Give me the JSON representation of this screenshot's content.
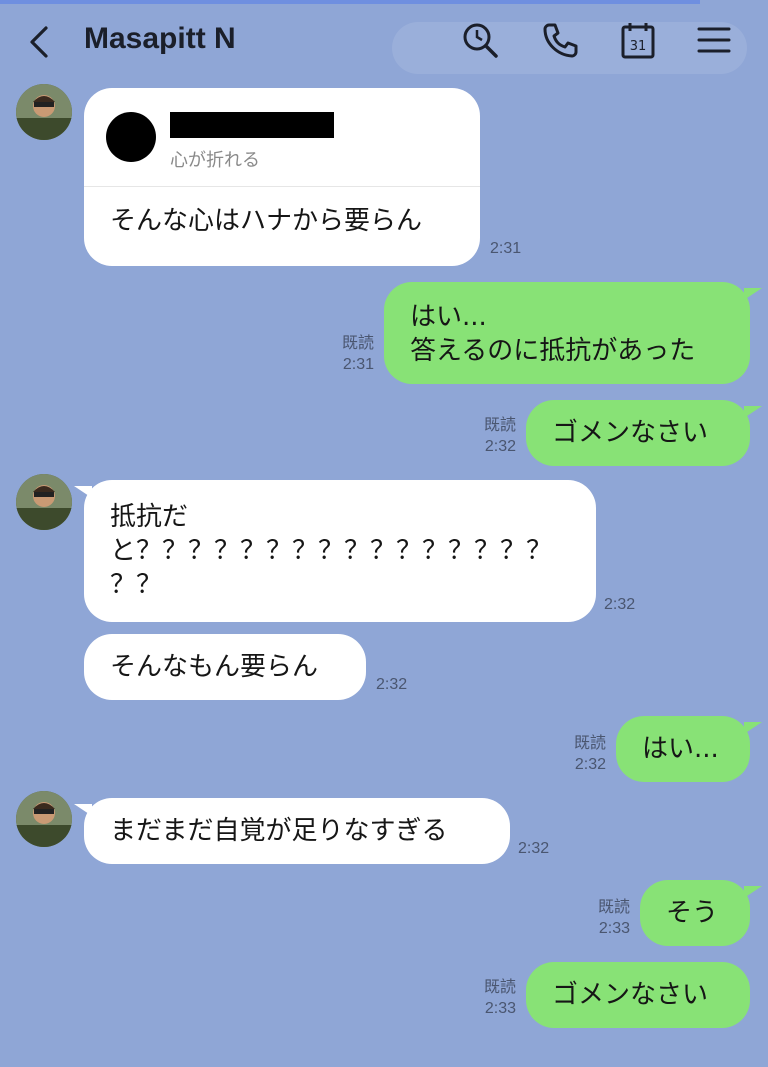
{
  "header": {
    "title": "Masapitt N",
    "icons": [
      "back-icon",
      "search-icon",
      "phone-icon",
      "calendar-icon",
      "menu-icon"
    ],
    "calendar_day": "31"
  },
  "shared_card": {
    "subtitle": "心が折れる"
  },
  "messages": [
    {
      "side": "left",
      "lines": [
        "そんな心はハナから要らん"
      ],
      "time": "2:31"
    },
    {
      "side": "right",
      "lines": [
        "はい...",
        "答えるのに抵抗があった"
      ],
      "read": "既読",
      "time": "2:31"
    },
    {
      "side": "right",
      "lines": [
        "ゴメンなさい"
      ],
      "read": "既読",
      "time": "2:32"
    },
    {
      "side": "left",
      "lines": [
        "抵抗だ",
        "と？？？？？？？？？？？？？？？？",
        "？？"
      ],
      "time": "2:32"
    },
    {
      "side": "left",
      "lines": [
        "そんなもん要らん"
      ],
      "time": "2:32"
    },
    {
      "side": "right",
      "lines": [
        "はい..."
      ],
      "read": "既読",
      "time": "2:32"
    },
    {
      "side": "left",
      "lines": [
        "まだまだ自覚が足りなすぎる"
      ],
      "time": "2:32"
    },
    {
      "side": "right",
      "lines": [
        "そう"
      ],
      "read": "既読",
      "time": "2:33"
    },
    {
      "side": "right",
      "lines": [
        "ゴメンなさい"
      ],
      "read": "既読",
      "time": "2:33"
    }
  ],
  "colors": {
    "background": "#8fa6d6",
    "sent_bubble": "#88e276",
    "received_bubble": "#ffffff"
  }
}
